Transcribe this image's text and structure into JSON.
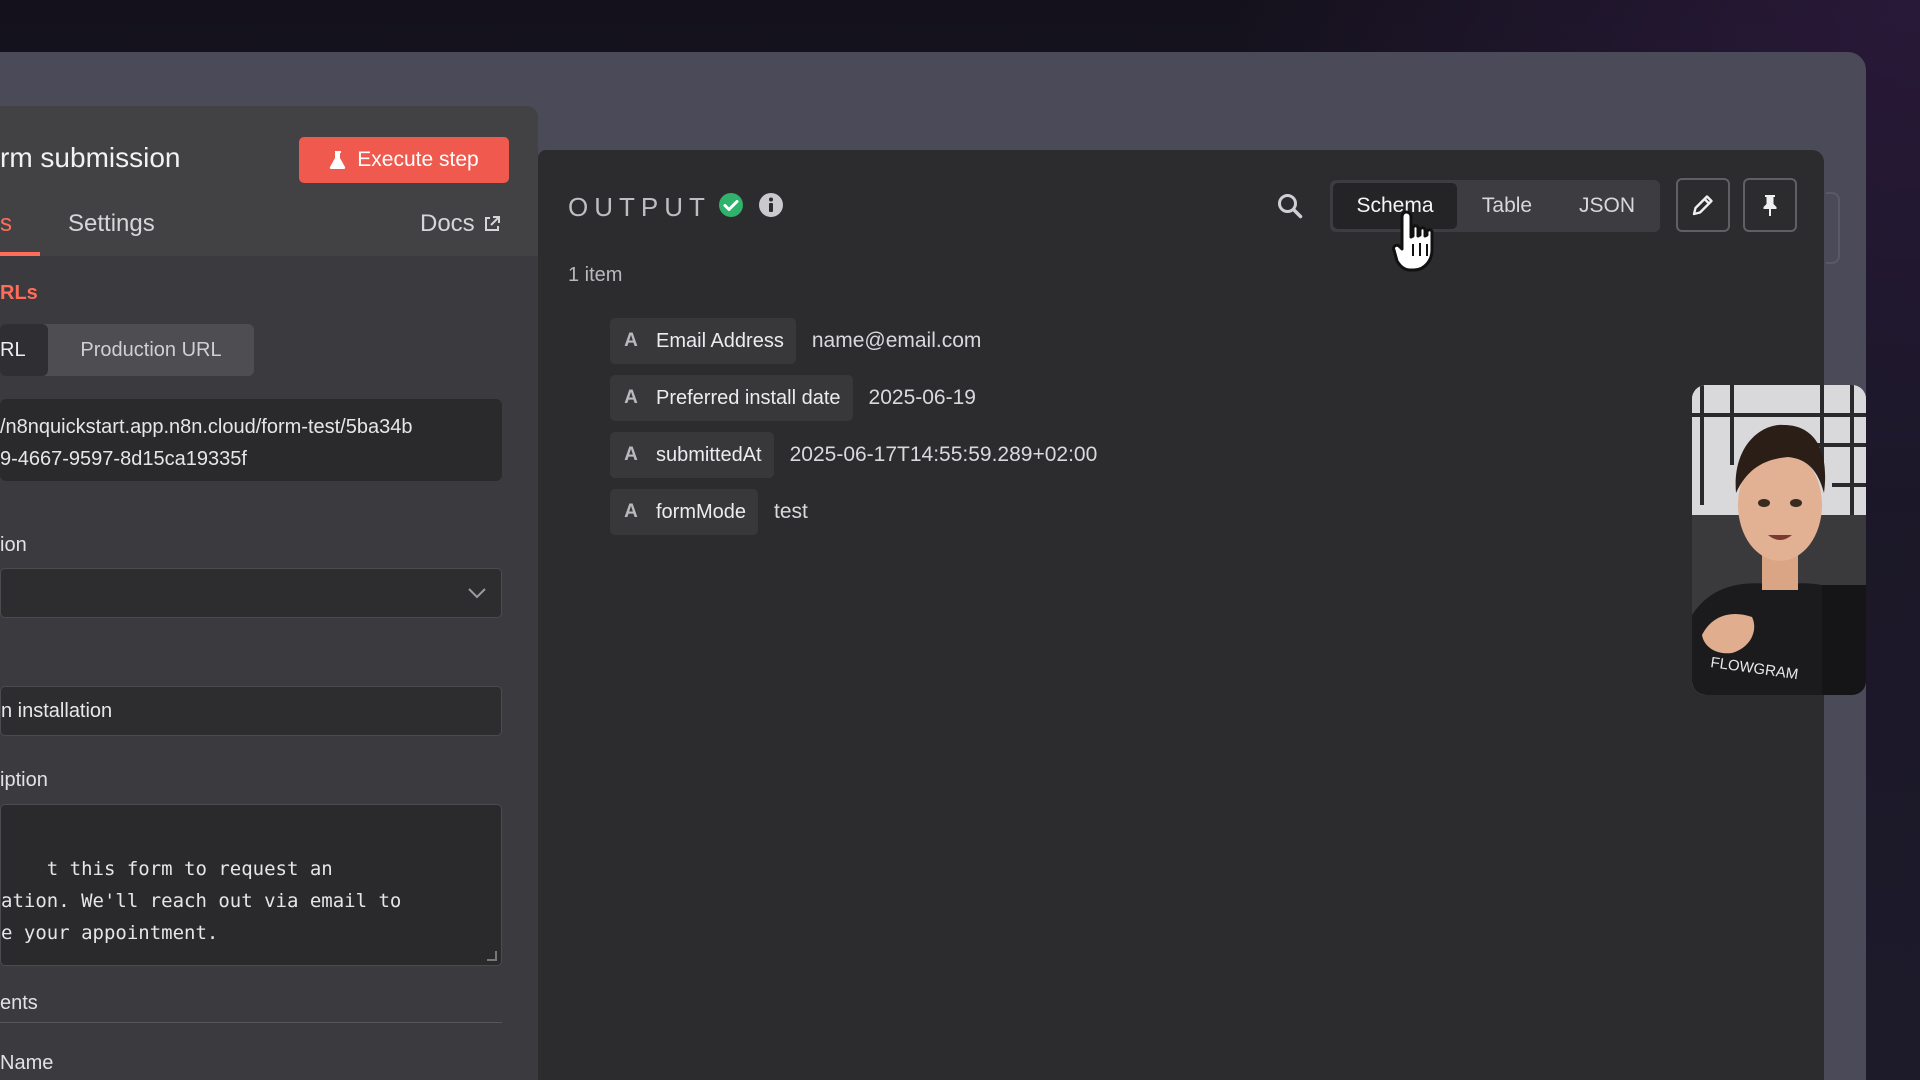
{
  "node": {
    "title": "rm submission",
    "execute_label": "Execute step",
    "tabs": {
      "parameters": "s",
      "settings": "Settings",
      "docs": "Docs"
    },
    "section_title": "RLs",
    "url_toggle": {
      "test": "RL",
      "production": "Production URL"
    },
    "url_lines": [
      "/n8nquickstart.app.n8n.cloud/form-test/5ba34b",
      "9-4667-9597-8d15ca19335f"
    ],
    "auth_label": "ion",
    "form_title_value": "n installation",
    "description_label": "iption",
    "description_value": "t this form to request an\nation. We'll reach out via email to\ne your appointment.",
    "elements_label": "ents",
    "name_label": "Name"
  },
  "output": {
    "title": "OUTPUT",
    "view_options": {
      "schema": "Schema",
      "table": "Table",
      "json": "JSON"
    },
    "active_view": "Schema",
    "item_count": "1 item",
    "fields": [
      {
        "type": "A",
        "key": "Email Address",
        "value": "name@email.com"
      },
      {
        "type": "A",
        "key": "Preferred install date",
        "value": "2025-06-19"
      },
      {
        "type": "A",
        "key": "submittedAt",
        "value": "2025-06-17T14:55:59.289+02:00"
      },
      {
        "type": "A",
        "key": "formMode",
        "value": "test"
      }
    ]
  },
  "icons": {
    "execute": "flask-icon",
    "docs": "external-link-icon",
    "status": "check-circle-icon",
    "info": "info-icon",
    "search": "search-icon",
    "edit": "pencil-icon",
    "pin": "pin-icon",
    "cursor": "hand-cursor-icon"
  },
  "colors": {
    "accent": "#ff6d5a",
    "execute_bg": "#f0594d",
    "success": "#2fb26b"
  },
  "webcam": {
    "shirt_text": "FLOWGRAM"
  }
}
